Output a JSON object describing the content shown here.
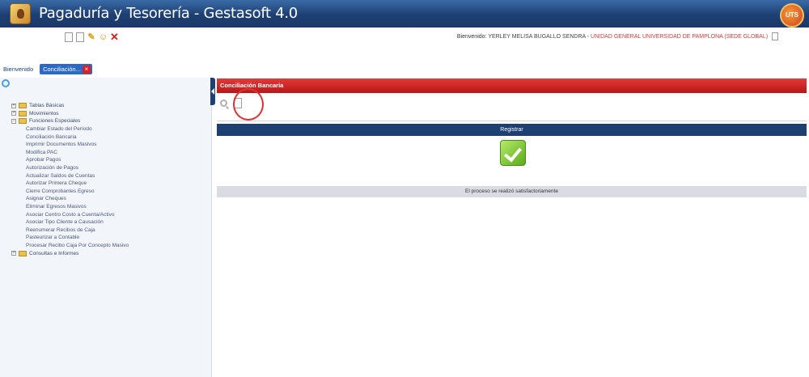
{
  "app": {
    "title": "Pagaduría y Tesorería - Gestasoft 4.0",
    "corner_logo_text": "UTS"
  },
  "header": {
    "welcome_label": "Bienvenido:",
    "user_name": "YERLEY MELISA BUGALLO SENDRA -",
    "unit": "UNIDAD GENERAL UNIVERSIDAD DE PAMPLONA (SEDE GLOBAL)"
  },
  "tabs": [
    {
      "label": "Bienvenido"
    },
    {
      "label": "Conciliación..."
    }
  ],
  "sidebar": {
    "groups": [
      {
        "label": "Tablas Básicas",
        "expanded": false
      },
      {
        "label": "Movimientos",
        "expanded": false
      },
      {
        "label": "Funciones Especiales",
        "expanded": true
      },
      {
        "label": "Consultas e Informes",
        "expanded": false
      }
    ],
    "children": [
      "Cambiar Estado del Período",
      "Conciliación Bancaria",
      "Imprimir Documentos Masivos",
      "Modifica PAC",
      "Aprobar Pagos",
      "Autorización de Pagos",
      "Actualizar Saldos de Cuentas",
      "Autorizar Primera Cheque",
      "Cierre Comprobantes Egreso",
      "Asignar Cheques",
      "Eliminar Egresos Masivos",
      "Asociar Centro Costo a Cuenta/Activo",
      "Asociar Tipo Cliente a Causación",
      "Reenumerar Recibos de Caja",
      "Pasteurizar a Contable",
      "Procesar Recibo Caja Por Concepto Masivo"
    ]
  },
  "panel": {
    "title": "Conciliación Bancaria",
    "table_header": "Registrar",
    "status_message": "El proceso se realizó satisfactoriamente"
  },
  "colors": {
    "header_blue": "#1d3f72",
    "panel_red": "#d02a2a",
    "success_green": "#5aaa1a"
  }
}
